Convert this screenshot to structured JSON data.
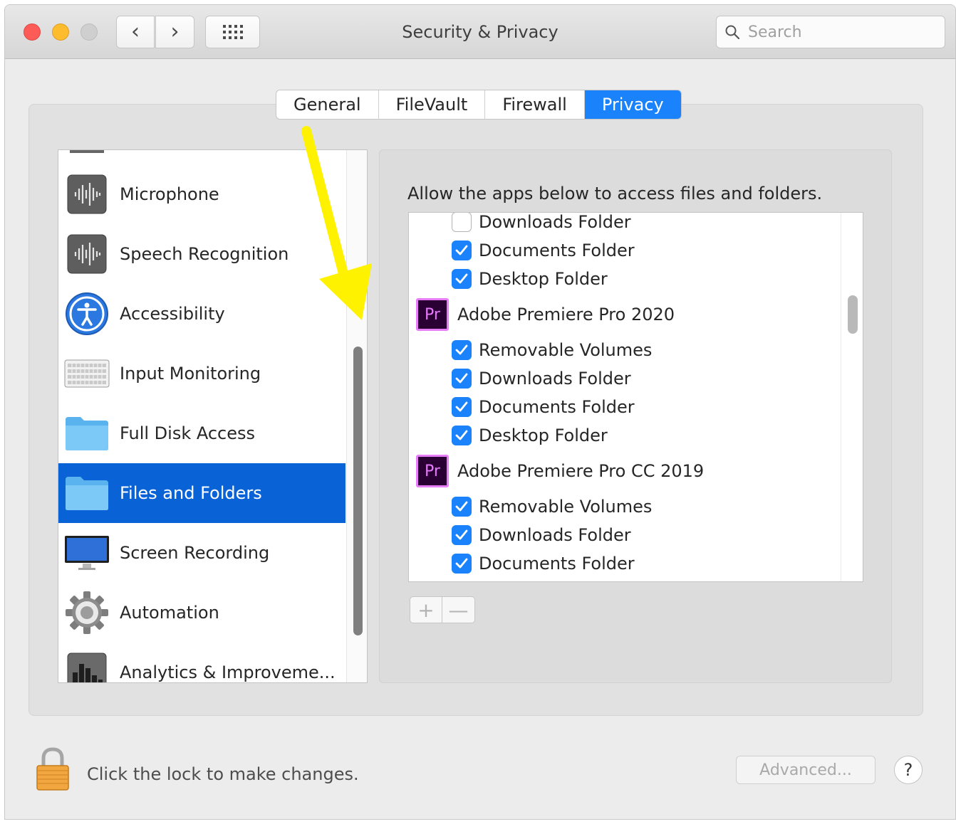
{
  "window": {
    "title": "Security & Privacy",
    "search_placeholder": "Search"
  },
  "toolbar": {
    "back_glyph": "‹",
    "forward_glyph": "›"
  },
  "tabs": [
    {
      "label": "General",
      "active": false
    },
    {
      "label": "FileVault",
      "active": false
    },
    {
      "label": "Firewall",
      "active": false
    },
    {
      "label": "Privacy",
      "active": true
    }
  ],
  "sidebar": {
    "items": [
      {
        "label": "Microphone",
        "icon": "microphone-waveform-icon"
      },
      {
        "label": "Speech Recognition",
        "icon": "speech-waveform-icon"
      },
      {
        "label": "Accessibility",
        "icon": "accessibility-icon"
      },
      {
        "label": "Input Monitoring",
        "icon": "keyboard-icon"
      },
      {
        "label": "Full Disk Access",
        "icon": "folder-icon"
      },
      {
        "label": "Files and Folders",
        "icon": "folder-icon",
        "selected": true
      },
      {
        "label": "Screen Recording",
        "icon": "display-icon"
      },
      {
        "label": "Automation",
        "icon": "gear-icon"
      },
      {
        "label": "Analytics & Improveme...",
        "icon": "bar-chart-icon"
      }
    ]
  },
  "files_panel": {
    "heading": "Allow the apps below to access files and folders.",
    "rows": [
      {
        "type": "perm",
        "label": "Downloads Folder",
        "checked": false
      },
      {
        "type": "perm",
        "label": "Documents Folder",
        "checked": true
      },
      {
        "type": "perm",
        "label": "Desktop Folder",
        "checked": true
      },
      {
        "type": "app",
        "label": "Adobe Premiere Pro 2020",
        "icon_text": "Pr"
      },
      {
        "type": "perm",
        "label": "Removable Volumes",
        "checked": true
      },
      {
        "type": "perm",
        "label": "Downloads Folder",
        "checked": true
      },
      {
        "type": "perm",
        "label": "Documents Folder",
        "checked": true
      },
      {
        "type": "perm",
        "label": "Desktop Folder",
        "checked": true
      },
      {
        "type": "app",
        "label": "Adobe Premiere Pro CC 2019",
        "icon_text": "Pr"
      },
      {
        "type": "perm",
        "label": "Removable Volumes",
        "checked": true
      },
      {
        "type": "perm",
        "label": "Downloads Folder",
        "checked": true
      },
      {
        "type": "perm",
        "label": "Documents Folder",
        "checked": true
      }
    ],
    "add_glyph": "+",
    "remove_glyph": "—"
  },
  "footer": {
    "lock_text": "Click the lock to make changes.",
    "advanced_label": "Advanced...",
    "help_label": "?"
  },
  "colors": {
    "accent": "#1a82fb",
    "selection": "#0a62d7",
    "annotation_arrow": "#fff200"
  }
}
